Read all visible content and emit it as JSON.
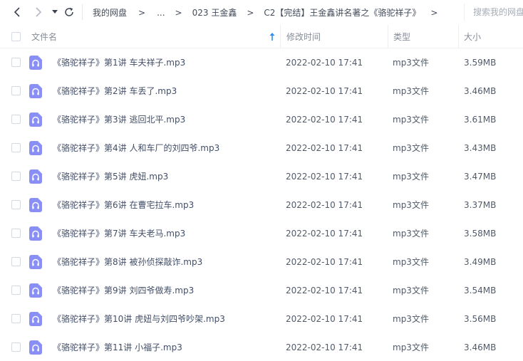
{
  "toolbar": {
    "back_icon": "chevron-left-icon",
    "forward_icon": "chevron-right-icon",
    "history_icon": "caret-down-icon",
    "refresh_icon": "refresh-icon"
  },
  "breadcrumb": {
    "items": [
      "我的网盘",
      "...",
      "023 王金鑫",
      "C2【完结】王金鑫讲名著之《骆驼祥子》"
    ],
    "separator": ">"
  },
  "search": {
    "placeholder": "搜索我的网盘文件"
  },
  "table": {
    "columns": {
      "name": "文件名",
      "modified": "修改时间",
      "type": "类型",
      "size": "大小"
    },
    "sort_icon": "arrow-up-icon",
    "file_icon": "audio-file-icon",
    "rows": [
      {
        "name": "《骆驼祥子》第1讲 车夫祥子.mp3",
        "modified": "2022-02-10 17:41",
        "type": "mp3文件",
        "size": "3.59MB"
      },
      {
        "name": "《骆驼祥子》第2讲 车丢了.mp3",
        "modified": "2022-02-10 17:41",
        "type": "mp3文件",
        "size": "3.46MB"
      },
      {
        "name": "《骆驼祥子》第3讲 逃回北平.mp3",
        "modified": "2022-02-10 17:41",
        "type": "mp3文件",
        "size": "3.61MB"
      },
      {
        "name": "《骆驼祥子》第4讲 人和车厂的刘四爷.mp3",
        "modified": "2022-02-10 17:41",
        "type": "mp3文件",
        "size": "3.43MB"
      },
      {
        "name": "《骆驼祥子》第5讲 虎妞.mp3",
        "modified": "2022-02-10 17:41",
        "type": "mp3文件",
        "size": "3.47MB"
      },
      {
        "name": "《骆驼祥子》第6讲 在曹宅拉车.mp3",
        "modified": "2022-02-10 17:41",
        "type": "mp3文件",
        "size": "3.37MB"
      },
      {
        "name": "《骆驼祥子》第7讲 车夫老马.mp3",
        "modified": "2022-02-10 17:41",
        "type": "mp3文件",
        "size": "3.58MB"
      },
      {
        "name": "《骆驼祥子》第8讲 被孙侦探敲诈.mp3",
        "modified": "2022-02-10 17:41",
        "type": "mp3文件",
        "size": "3.49MB"
      },
      {
        "name": "《骆驼祥子》第9讲 刘四爷做寿.mp3",
        "modified": "2022-02-10 17:41",
        "type": "mp3文件",
        "size": "3.54MB"
      },
      {
        "name": "《骆驼祥子》第10讲 虎妞与刘四爷吵架.mp3",
        "modified": "2022-02-10 17:41",
        "type": "mp3文件",
        "size": "3.56MB"
      },
      {
        "name": "《骆驼祥子》第11讲 小福子.mp3",
        "modified": "2022-02-10 17:41",
        "type": "mp3文件",
        "size": "3.46MB"
      }
    ]
  },
  "colors": {
    "file_icon": "#8a8ff5",
    "sort_arrow": "#2f8cf0"
  }
}
